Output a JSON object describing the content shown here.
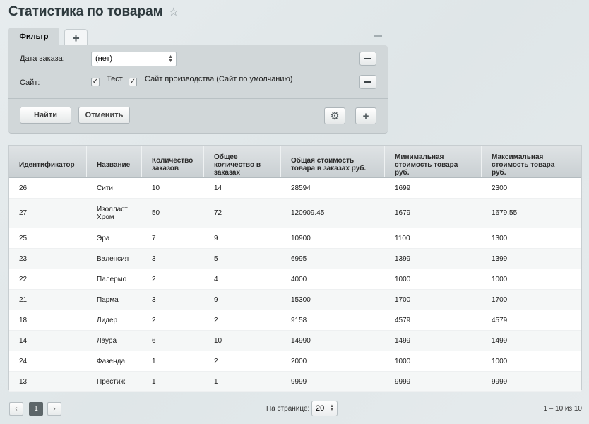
{
  "page": {
    "title": "Статистика по товарам",
    "star_icon": "star-icon"
  },
  "filter": {
    "tab_label": "Фильтр",
    "add_tab_label": "+",
    "order_date_label": "Дата заказа:",
    "order_date_value": "(нет)",
    "site_label": "Сайт:",
    "site_options": [
      {
        "label": "Тест",
        "checked": true
      },
      {
        "label": "Сайт производства (Сайт по умолчанию)",
        "checked": true
      }
    ],
    "find_button": "Найти",
    "cancel_button": "Отменить"
  },
  "table": {
    "columns": [
      [
        "Идентификатор"
      ],
      [
        "Название"
      ],
      [
        "Количество",
        "заказов"
      ],
      [
        "Общее",
        "количество в",
        "заказах"
      ],
      [
        "Общая стоимость",
        "товара в заказах руб."
      ],
      [
        "Минимальная",
        "стоимость товара",
        "руб."
      ],
      [
        "Максимальная",
        "стоимость товара",
        "руб."
      ]
    ],
    "rows": [
      {
        "id": "26",
        "name": [
          "Сити"
        ],
        "orders": "10",
        "qty": "14",
        "total": "28594",
        "min": "1699",
        "max": "2300"
      },
      {
        "id": "27",
        "name": [
          "Изолласт",
          "Хром"
        ],
        "orders": "50",
        "qty": "72",
        "total": "120909.45",
        "min": "1679",
        "max": "1679.55"
      },
      {
        "id": "25",
        "name": [
          "Эра"
        ],
        "orders": "7",
        "qty": "9",
        "total": "10900",
        "min": "1100",
        "max": "1300"
      },
      {
        "id": "23",
        "name": [
          "Валенсия"
        ],
        "orders": "3",
        "qty": "5",
        "total": "6995",
        "min": "1399",
        "max": "1399"
      },
      {
        "id": "22",
        "name": [
          "Палермо"
        ],
        "orders": "2",
        "qty": "4",
        "total": "4000",
        "min": "1000",
        "max": "1000"
      },
      {
        "id": "21",
        "name": [
          "Парма"
        ],
        "orders": "3",
        "qty": "9",
        "total": "15300",
        "min": "1700",
        "max": "1700"
      },
      {
        "id": "18",
        "name": [
          "Лидер"
        ],
        "orders": "2",
        "qty": "2",
        "total": "9158",
        "min": "4579",
        "max": "4579"
      },
      {
        "id": "14",
        "name": [
          "Лаура"
        ],
        "orders": "6",
        "qty": "10",
        "total": "14990",
        "min": "1499",
        "max": "1499"
      },
      {
        "id": "24",
        "name": [
          "Фазенда"
        ],
        "orders": "1",
        "qty": "2",
        "total": "2000",
        "min": "1000",
        "max": "1000"
      },
      {
        "id": "13",
        "name": [
          "Престиж"
        ],
        "orders": "1",
        "qty": "1",
        "total": "9999",
        "min": "9999",
        "max": "9999"
      }
    ]
  },
  "pager": {
    "prev": "‹",
    "current_page": "1",
    "next": "›",
    "per_page_label": "На странице:",
    "per_page_value": "20",
    "total_label": "1 – 10 из 10"
  }
}
